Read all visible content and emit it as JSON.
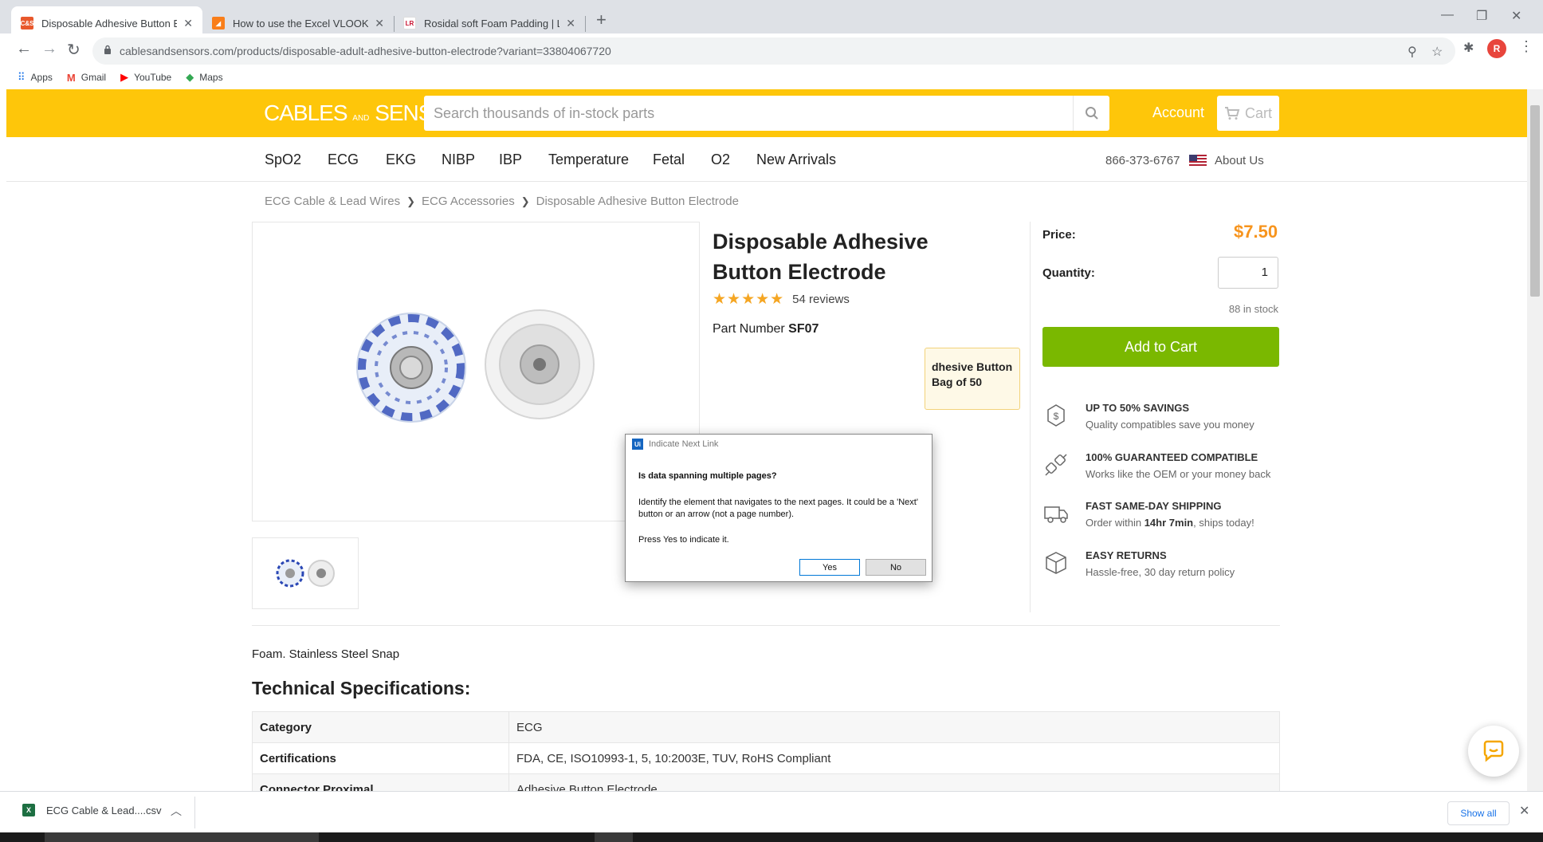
{
  "browser": {
    "tabs": [
      {
        "title": "Disposable Adhesive Button Elec",
        "favicon_text": "C&S",
        "favicon_color": "#e8582c",
        "active": true
      },
      {
        "title": "How to use the Excel VLOOKUP F",
        "favicon_text": "",
        "favicon_color": "#f97e1a",
        "active": false
      },
      {
        "title": "Rosidal soft Foam Padding | L&R",
        "favicon_text": "LR",
        "favicon_color": "#ffffff",
        "active": false
      }
    ],
    "url": "cablesandsensors.com/products/disposable-adult-adhesive-button-electrode?variant=33804067720",
    "profile_initial": "R",
    "bookmarks": [
      {
        "label": "Apps",
        "icon": "apps-grid-icon"
      },
      {
        "label": "Gmail",
        "icon": "gmail-icon"
      },
      {
        "label": "YouTube",
        "icon": "youtube-icon"
      },
      {
        "label": "Maps",
        "icon": "maps-icon"
      }
    ]
  },
  "site": {
    "brand_color": "#fec60a",
    "logo_left": "CABLES",
    "logo_and": "AND",
    "logo_right": "SENSORS",
    "search_placeholder": "Search thousands of in-stock parts",
    "account_label": "Account",
    "cart_label": "Cart",
    "nav": [
      "SpO2",
      "ECG",
      "EKG",
      "NIBP",
      "IBP",
      "Temperature",
      "Fetal",
      "O2",
      "New Arrivals"
    ],
    "phone": "866-373-6767",
    "about_label": "About Us"
  },
  "breadcrumb": [
    "ECG Cable & Lead Wires",
    "ECG Accessories",
    "Disposable Adhesive Button Electrode"
  ],
  "product": {
    "title": "Disposable Adhesive Button Electrode",
    "stars": "★★★★★",
    "reviews": "54 reviews",
    "part_label": "Part Number",
    "part_number": "SF07",
    "notice_line1": "dhesive Button",
    "notice_line2": "Bag of 50",
    "price_label": "Price:",
    "price": "$7.50",
    "price_color": "#f7941d",
    "quantity_label": "Quantity:",
    "quantity": "1",
    "stock": "88 in stock",
    "add_to_cart": "Add to Cart",
    "add_to_cart_color": "#7ab800",
    "features": [
      {
        "icon": "savings-coin-icon",
        "title": "UP TO 50% SAVINGS",
        "text": "Quality compatibles save you money"
      },
      {
        "icon": "plug-connector-icon",
        "title": "100% GUARANTEED COMPATIBLE",
        "text": "Works like the OEM or your money back"
      },
      {
        "icon": "delivery-truck-icon",
        "title": "FAST SAME-DAY SHIPPING",
        "text_prefix": "Order within ",
        "text_bold": "14hr 7min",
        "text_suffix": ", ships today!"
      },
      {
        "icon": "return-box-icon",
        "title": "EASY RETURNS",
        "text": "Hassle-free, 30 day return policy"
      }
    ],
    "description": "Foam. Stainless Steel Snap",
    "tech_title": "Technical Specifications:",
    "specs": [
      {
        "key": "Category",
        "value": "ECG"
      },
      {
        "key": "Certifications",
        "value": "FDA, CE, ISO10993-1, 5, 10:2003E, TUV, RoHS Compliant"
      },
      {
        "key": "Connector Proximal",
        "value": "Adhesive Button Electrode"
      }
    ]
  },
  "dialog": {
    "title": "Indicate Next Link",
    "question": "Is data spanning multiple pages?",
    "message": "Identify the element that navigates to the next pages. It could be a 'Next' button or an arrow (not a page number).",
    "press": "Press Yes to indicate it.",
    "yes": "Yes",
    "no": "No"
  },
  "downloads": {
    "file": "ECG Cable & Lead....csv",
    "show_all": "Show all"
  }
}
